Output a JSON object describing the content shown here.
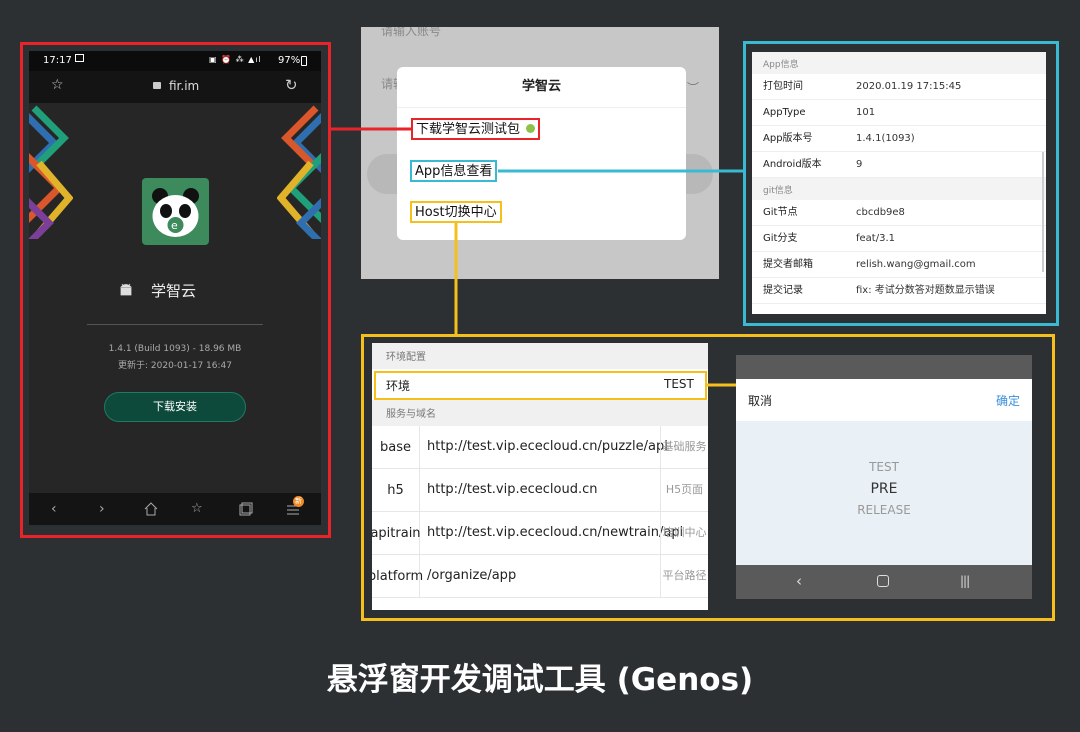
{
  "phone": {
    "status": {
      "time": "17:17",
      "battery": "97%"
    },
    "url": "fir.im",
    "app_name": "学智云",
    "version": "1.4.1 (Build 1093) - 18.96 MB",
    "updated": "更新于: 2020-01-17 16:47",
    "download_button": "下载安装",
    "nav_badge": "新"
  },
  "login": {
    "account_placeholder": "请输入账号",
    "password_placeholder": "请输入密码"
  },
  "dialog": {
    "title": "学智云",
    "options": [
      "下载学智云测试包",
      "App信息查看",
      "Host切换中心"
    ]
  },
  "app_info": {
    "section_app": "App信息",
    "rows_app": [
      {
        "k": "打包时间",
        "v": "2020.01.19 17:15:45"
      },
      {
        "k": "AppType",
        "v": "101"
      },
      {
        "k": "App版本号",
        "v": "1.4.1(1093)"
      },
      {
        "k": "Android版本",
        "v": "9"
      }
    ],
    "section_git": "git信息",
    "rows_git": [
      {
        "k": "Git节点",
        "v": "cbcdb9e8"
      },
      {
        "k": "Git分支",
        "v": "feat/3.1"
      },
      {
        "k": "提交者邮箱",
        "v": "relish.wang@gmail.com"
      },
      {
        "k": "提交记录",
        "v": "fix: 考试分数答对题数显示错误"
      }
    ]
  },
  "env_config": {
    "section_env": "环境配置",
    "env_label": "环境",
    "env_value": "TEST",
    "section_services": "服务与域名",
    "rows": [
      {
        "k": "base",
        "v": "http://test.vip.ececloud.cn/puzzle/api",
        "d": "基础服务"
      },
      {
        "k": "h5",
        "v": "http://test.vip.ececloud.cn",
        "d": "H5页面"
      },
      {
        "k": "apitrain",
        "v": "http://test.vip.ececloud.cn/newtrain/api",
        "d": "培训中心"
      },
      {
        "k": "platform",
        "v": "/organize/app",
        "d": "平台路径"
      }
    ]
  },
  "picker": {
    "cancel": "取消",
    "confirm": "确定",
    "options": [
      "TEST",
      "PRE",
      "RELEASE"
    ],
    "selected": "PRE"
  },
  "caption": "悬浮窗开发调试工具 (Genos)",
  "colors": {
    "download_frame": "#e8232a",
    "info_frame": "#3ab9d2",
    "host_frame": "#f5c01b",
    "accent_blue": "#3a8fd8",
    "status_dot": "#8bc34a"
  },
  "icons": [
    "star-icon",
    "lock-icon",
    "refresh-icon",
    "android-icon",
    "back-icon",
    "forward-icon",
    "home-icon",
    "bookmark-icon",
    "tabs-icon",
    "menu-icon",
    "eye-closed-icon"
  ]
}
